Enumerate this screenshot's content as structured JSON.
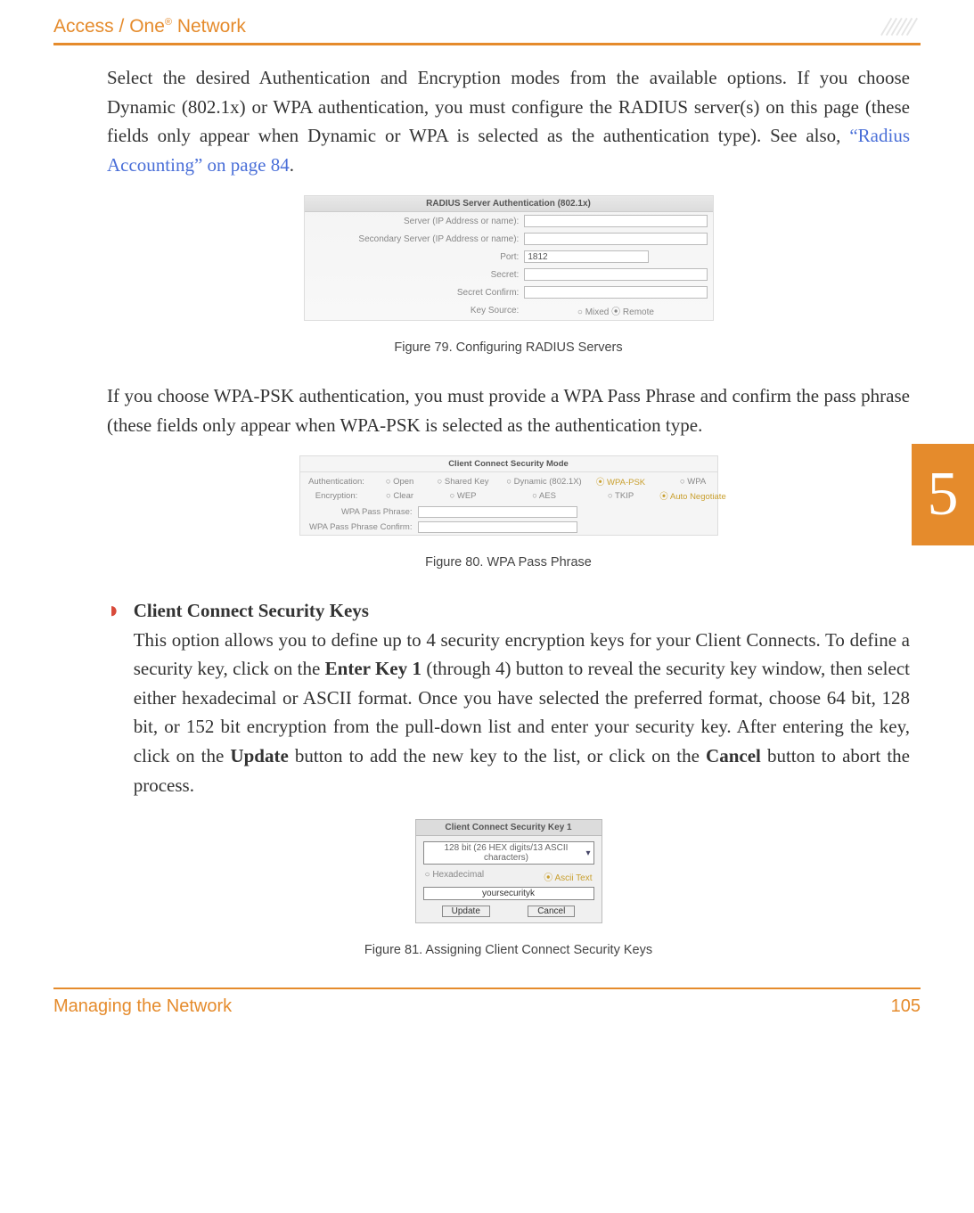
{
  "header": {
    "brand_prefix": "Access / One",
    "brand_reg": "®",
    "brand_suffix": " Network"
  },
  "side_tab": {
    "chapter": "5"
  },
  "body": {
    "para1_text": "Select the desired Authentication and Encryption modes from the available options. If you choose Dynamic (802.1x) or WPA authentication, you must configure the RADIUS server(s) on this page (these fields only appear when Dynamic or WPA is selected as the authentication type). See also, ",
    "para1_link": "“Radius Accounting” on page 84",
    "para1_tail": ".",
    "radius_form": {
      "heading": "RADIUS Server Authentication (802.1x)",
      "rows": {
        "server": "Server (IP Address or name):",
        "secondary": "Secondary Server (IP Address or name):",
        "port_label": "Port:",
        "port_value": "1812",
        "secret": "Secret:",
        "secret_confirm": "Secret Confirm:",
        "key_source_label": "Key Source:",
        "key_source_opts": "○ Mixed  ⦿ Remote"
      }
    },
    "fig79": "Figure 79. Configuring RADIUS Servers",
    "para2": "If you choose WPA-PSK authentication, you must provide a WPA Pass Phrase and confirm the pass phrase (these fields only appear when WPA-PSK is selected as the authentication type.",
    "wpa_form": {
      "heading": "Client Connect Security Mode",
      "auth_label": "Authentication:",
      "enc_label": "Encryption:",
      "auth_opts": {
        "open": "○ Open",
        "shared": "○ Shared Key",
        "dynamic": "○ Dynamic (802.1X)",
        "wpapsk": "⦿ WPA-PSK",
        "wpa": "○ WPA"
      },
      "enc_opts": {
        "clear": "○ Clear",
        "wep": "○ WEP",
        "aes": "○ AES",
        "tkip": "○ TKIP",
        "auto": "⦿ Auto Negotiate"
      },
      "pass_label": "WPA Pass Phrase:",
      "confirm_label": "WPA Pass Phrase Confirm:"
    },
    "fig80": "Figure 80. WPA Pass Phrase",
    "sec3_heading": "Client Connect Security Keys",
    "sec3_part1": "This option allows you to define up to 4 security encryption keys for your Client Connects. To define a security key, click on the ",
    "sec3_b1": "Enter Key 1",
    "sec3_part2": " (through 4) button to reveal the security key window, then select either hexadecimal or ASCII format. Once you have selected the preferred format, choose 64 bit, 128 bit, or 152 bit encryption from the pull-down list and enter your security key. After entering the key, click on the ",
    "sec3_b2": "Update",
    "sec3_part3": " button to add the new key to the list, or click on the ",
    "sec3_b3": "Cancel",
    "sec3_part4": " button to abort the process.",
    "key_form": {
      "heading": "Client Connect Security Key 1",
      "select": "128 bit (26 HEX digits/13 ASCII characters)",
      "hex": "○ Hexadecimal",
      "ascii": "⦿ Ascii Text",
      "value": "yoursecurityk",
      "update": "Update",
      "cancel": "Cancel"
    },
    "fig81": "Figure 81. Assigning Client Connect Security Keys"
  },
  "footer": {
    "section": "Managing the Network",
    "page": "105"
  }
}
